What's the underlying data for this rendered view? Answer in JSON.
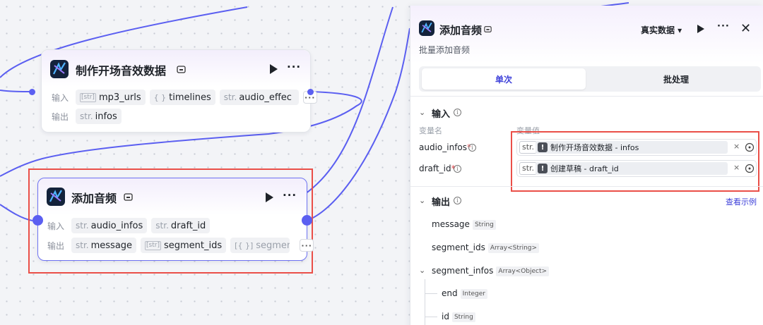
{
  "canvas": {
    "node_make": {
      "title": "制作开场音效数据",
      "input_label": "输入",
      "output_label": "输出",
      "inputs": [
        {
          "type": "[str]",
          "name": "mp3_urls"
        },
        {
          "type": "{ }",
          "name": "timelines"
        },
        {
          "type": "str.",
          "name": "audio_effec"
        }
      ],
      "outputs": [
        {
          "type": "str.",
          "name": "infos"
        }
      ]
    },
    "node_add": {
      "title": "添加音频",
      "input_label": "输入",
      "output_label": "输出",
      "inputs": [
        {
          "type": "str.",
          "name": "audio_infos"
        },
        {
          "type": "str.",
          "name": "draft_id"
        }
      ],
      "outputs": [
        {
          "type": "str.",
          "name": "message"
        },
        {
          "type": "[str]",
          "name": "segment_ids"
        },
        {
          "type": "[{ }]",
          "name": "segment"
        }
      ]
    },
    "more_glyph": "···"
  },
  "panel": {
    "title": "添加音频",
    "subtitle": "批量添加音频",
    "mode_select": "真实数据 ▾",
    "close_glyph": "✕",
    "tabs": {
      "single": "单次",
      "batch": "批处理"
    },
    "input_section": {
      "title": "输入",
      "col_name": "变量名",
      "col_value": "变量值",
      "rows": [
        {
          "name": "audio_infos",
          "required": "*",
          "type": "str.",
          "ref": "制作开场音效数据 - infos"
        },
        {
          "name": "draft_id",
          "required": "*",
          "type": "str.",
          "ref": "创建草稿 - draft_id"
        }
      ]
    },
    "output_section": {
      "title": "输出",
      "example_link": "查看示例",
      "fields": [
        {
          "name": "message",
          "type": "String"
        },
        {
          "name": "segment_ids",
          "type": "Array<String>"
        },
        {
          "name": "segment_infos",
          "type": "Array<Object>"
        },
        {
          "name": "end",
          "type": "Integer"
        },
        {
          "name": "id",
          "type": "String"
        }
      ]
    }
  },
  "colors": {
    "accent": "#5b5ff1",
    "highlight": "#ea4f48",
    "link": "#3c3fd9"
  }
}
